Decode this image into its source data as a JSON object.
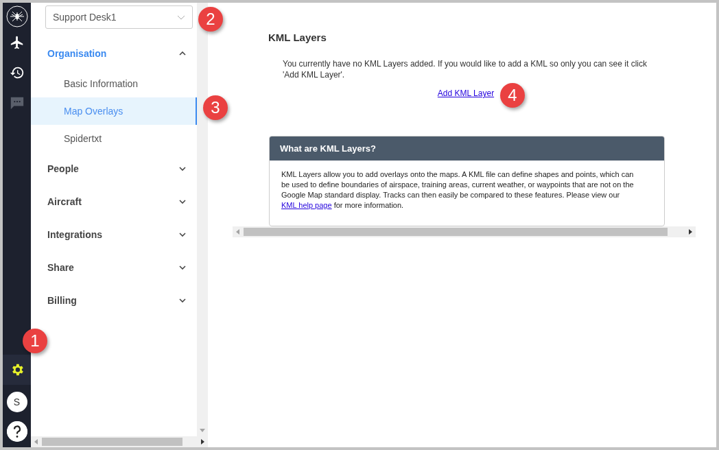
{
  "rail": {
    "items": [
      {
        "kind": "plane",
        "selected": false
      },
      {
        "kind": "history",
        "selected": false
      },
      {
        "kind": "chat",
        "selected": false
      }
    ],
    "bottom": [
      {
        "kind": "settings",
        "selected": true
      }
    ],
    "avatar": "S"
  },
  "workspace": {
    "value": "Support Desk1"
  },
  "sidebar": {
    "sections": [
      {
        "label": "Organisation",
        "expanded": true,
        "children": [
          {
            "label": "Basic Information",
            "selected": false
          },
          {
            "label": "Map Overlays",
            "selected": true
          },
          {
            "label": "Spidertxt",
            "selected": false
          }
        ]
      },
      {
        "label": "People",
        "expanded": false
      },
      {
        "label": "Aircraft",
        "expanded": false
      },
      {
        "label": "Integrations",
        "expanded": false
      },
      {
        "label": "Share",
        "expanded": false
      },
      {
        "label": "Billing",
        "expanded": false
      }
    ]
  },
  "main": {
    "title": "KML Layers",
    "message": "You currently have no KML Layers added. If you would like to add a KML so only you can see it click 'Add KML Layer'.",
    "add_link": "Add KML Layer",
    "info_card": {
      "title": "What are KML Layers?",
      "text_before": "KML Layers allow you to add overlays onto the maps. A KML file can define shapes and points, which can be used to define boundaries of airspace, training areas, current weather, or waypoints that are not on the Google Map standard display. Tracks can then easily be compared to these features. Please view our ",
      "link": "KML help page",
      "text_after": " for more information."
    }
  },
  "callouts": [
    "1",
    "2",
    "3",
    "4"
  ]
}
